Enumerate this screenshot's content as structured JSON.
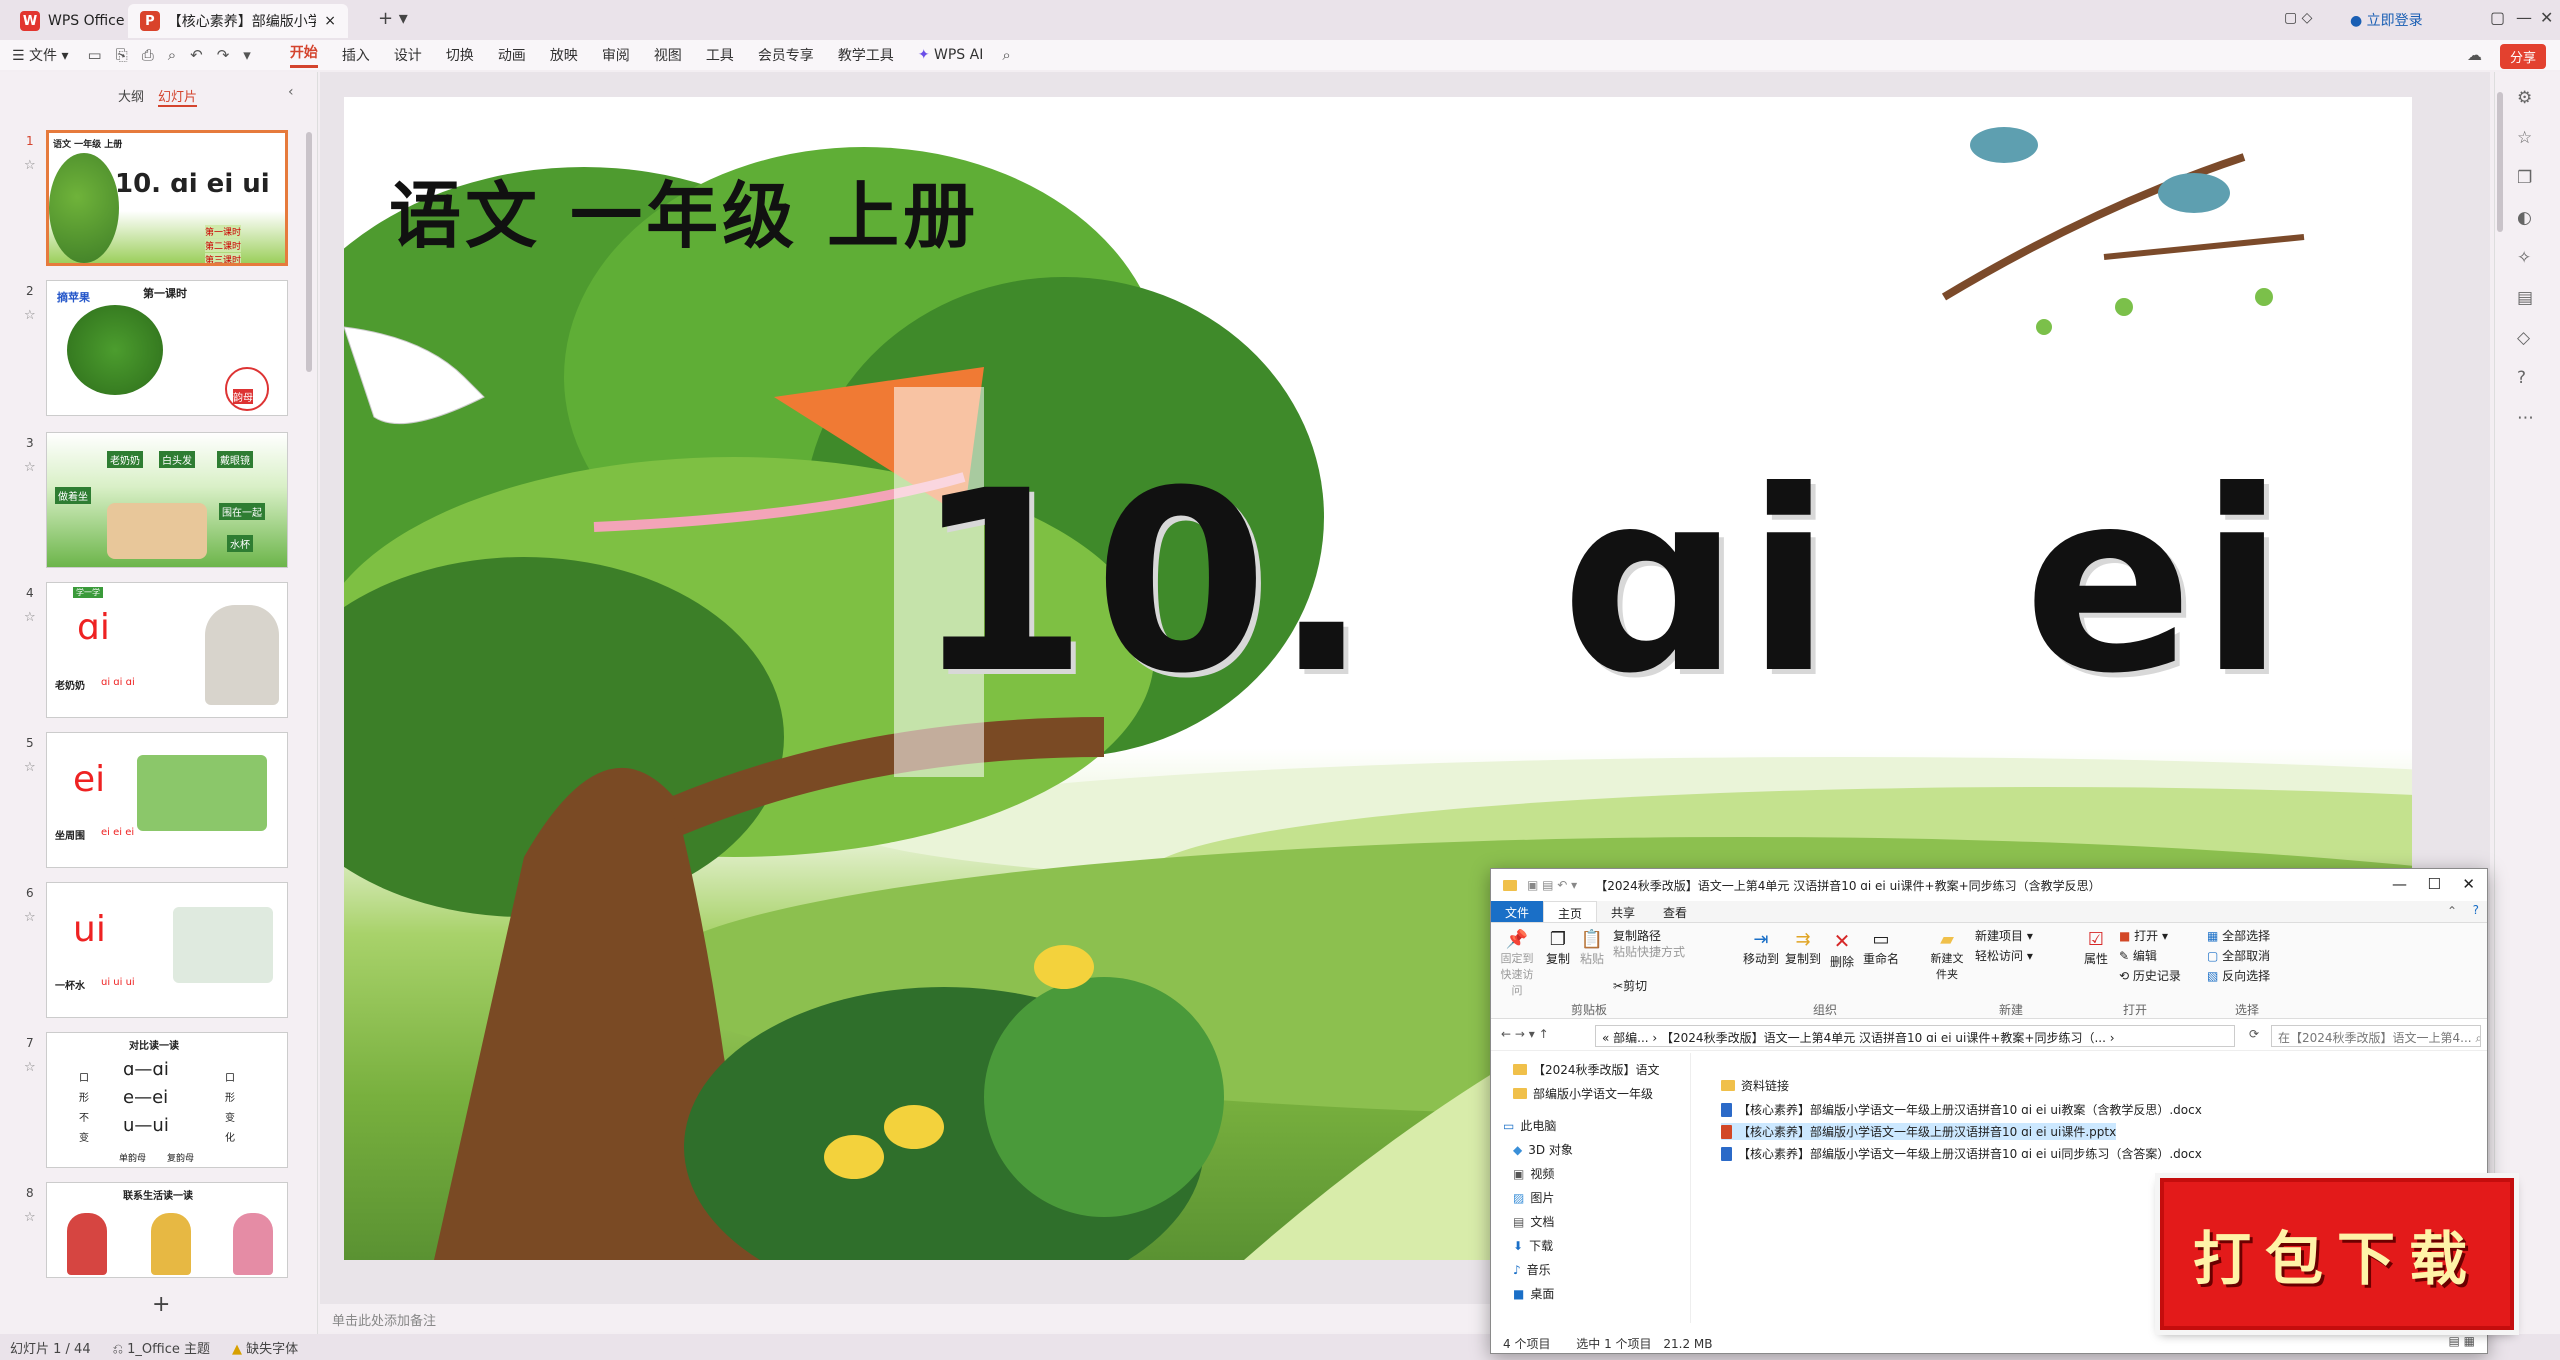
{
  "titlebar": {
    "app_tab": "WPS Office",
    "doc_tab": "【核心素养】部编版小学语文",
    "login": "立即登录"
  },
  "menubar": {
    "file": "文件",
    "items": [
      "开始",
      "插入",
      "设计",
      "切换",
      "动画",
      "放映",
      "审阅",
      "视图",
      "工具",
      "会员专享",
      "教学工具"
    ],
    "wps_ai": "WPS AI",
    "share": "分享"
  },
  "left_panel": {
    "tab_outline": "大纲",
    "tab_slides": "幻灯片",
    "slides": [
      {
        "num": "1",
        "title": "10. ɑi ei ui",
        "label": "语文 一年级 上册",
        "lines": [
          "第一课时",
          "第二课时",
          "第三课时"
        ]
      },
      {
        "num": "2",
        "title": "第一课时",
        "label": "摘苹果",
        "extra": "韵母"
      },
      {
        "num": "3",
        "labels": [
          "老奶奶",
          "白头发",
          "戴眼镜",
          "做着坐",
          "围在一起",
          "水杯"
        ]
      },
      {
        "num": "4",
        "big": "ɑi",
        "caption": "老奶奶",
        "pinyin": "ɑi ɑi ɑi",
        "tag": "学一学"
      },
      {
        "num": "5",
        "big": "ei",
        "caption": "坐周围",
        "pinyin": "ei ei ei"
      },
      {
        "num": "6",
        "big": "ui",
        "caption": "一杯水",
        "pinyin": "ui ui ui"
      },
      {
        "num": "7",
        "title": "对比读一读",
        "rows": [
          "ɑ—ɑi",
          "e—ei",
          "u—ui"
        ],
        "left": [
          "口",
          "形",
          "不",
          "变"
        ],
        "right": [
          "口",
          "形",
          "变",
          "化"
        ],
        "foot": [
          "单韵母",
          "复韵母"
        ]
      },
      {
        "num": "8",
        "title": "联系生活读一读"
      }
    ],
    "add": "+"
  },
  "slide": {
    "subject": "语文 一年级 上册",
    "lesson": "10.  ɑi  ei  ui"
  },
  "notes_placeholder": "单击此处添加备注",
  "statusbar": {
    "slide_count": "幻灯片 1 / 44",
    "theme": "1_Office 主题",
    "font_warn": "缺失字体"
  },
  "explorer": {
    "title": "【2024秋季改版】语文一上第4单元 汉语拼音10 ɑi ei ui课件+教案+同步练习（含教学反思）",
    "tabs": [
      "文件",
      "主页",
      "共享",
      "查看"
    ],
    "ribbon": {
      "pin": "固定到快速访问",
      "copy": "复制",
      "paste": "粘贴",
      "copy_path": "复制路径",
      "paste_shortcut": "粘贴快捷方式",
      "cut": "剪切",
      "clipboard": "剪贴板",
      "move_to": "移动到",
      "copy_to": "复制到",
      "delete": "删除",
      "rename": "重命名",
      "organize": "组织",
      "new_folder": "新建文件夹",
      "new_item": "新建项目",
      "easy_access": "轻松访问",
      "new": "新建",
      "properties": "属性",
      "open": "打开",
      "edit": "编辑",
      "history": "历史记录",
      "open_group": "打开",
      "select_all": "全部选择",
      "select_none": "全部取消",
      "invert": "反向选择",
      "select_group": "选择"
    },
    "address": "« 部编... › 【2024秋季改版】语文一上第4单元 汉语拼音10 ɑi ei ui课件+教案+同步练习（... ›",
    "search": "在【2024秋季改版】语文一上第4...",
    "nav": [
      "【2024秋季改版】语文",
      "部编版小学语文一年级",
      "此电脑",
      "3D 对象",
      "视频",
      "图片",
      "文档",
      "下载",
      "音乐",
      "桌面"
    ],
    "files": [
      {
        "name": "资料链接",
        "type": "folder"
      },
      {
        "name": "【核心素养】部编版小学语文一年级上册汉语拼音10 ɑi ei ui教案（含教学反思）.docx",
        "type": "doc"
      },
      {
        "name": "【核心素养】部编版小学语文一年级上册汉语拼音10 ɑi ei ui课件.pptx",
        "type": "ppt"
      },
      {
        "name": "【核心素养】部编版小学语文一年级上册汉语拼音10 ɑi ei ui同步练习（含答案）.docx",
        "type": "doc"
      }
    ],
    "status_count": "4 个项目",
    "status_sel": "选中 1 个项目",
    "status_size": "21.2 MB"
  },
  "badge": "打包下载"
}
